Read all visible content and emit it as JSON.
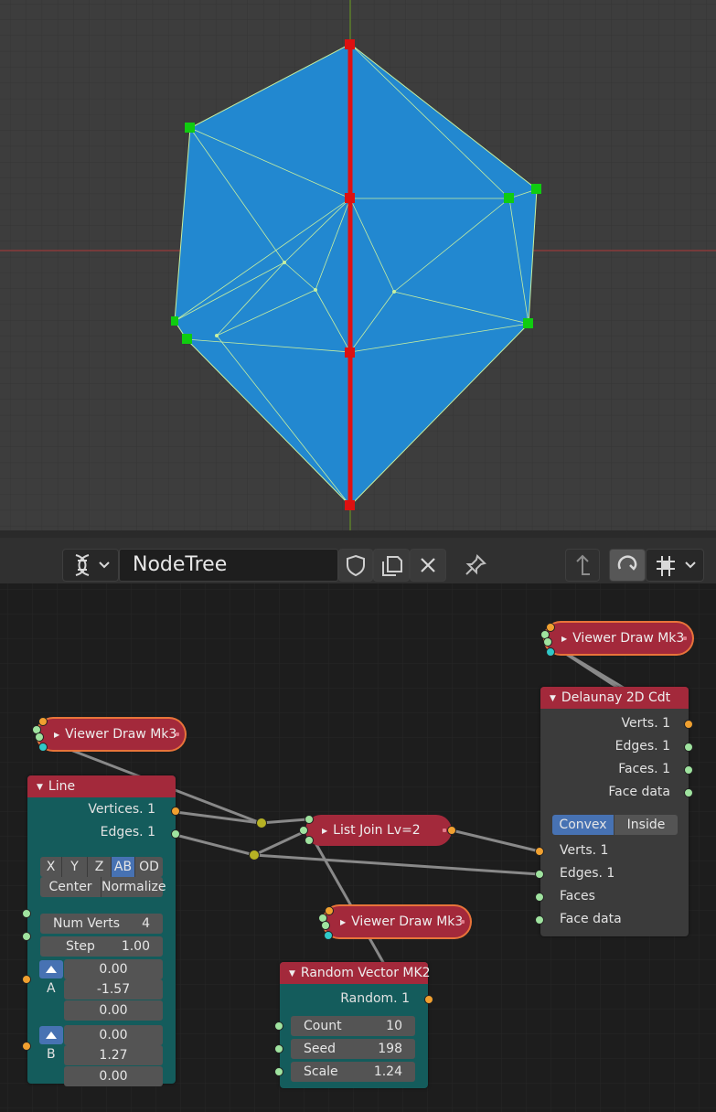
{
  "header": {
    "tree_name": "NodeTree",
    "icons": [
      "sverchok-icon",
      "chevron-down-icon",
      "shield-icon",
      "duplicate-icon",
      "close-icon",
      "pin-icon",
      "parent-tree-icon",
      "snap-icon",
      "grid-snap-icon",
      "chevron-down-icon"
    ]
  },
  "colors": {
    "mesh_fill": "#2288d0",
    "mesh_edge": "#c8f0a0",
    "vertex_green": "#10cc10",
    "vertex_red": "#dd1010",
    "line_red": "#e01010",
    "node_header": "#a3293b",
    "node_body_teal": "#145c5c",
    "node_body_grey": "#3b3b3b",
    "selection_outline": "#e8743a",
    "toggle_active": "#4772b3"
  },
  "nodes": {
    "viewer_top": {
      "title": "Viewer Draw Mk3"
    },
    "viewer_left": {
      "title": "Viewer Draw Mk3"
    },
    "viewer_mid": {
      "title": "Viewer Draw Mk3"
    },
    "list_join": {
      "title": "List Join Lv=2"
    },
    "line": {
      "title": "Line",
      "outputs": [
        "Vertices. 1",
        "Edges. 1"
      ],
      "axis_buttons": [
        "X",
        "Y",
        "Z",
        "AB",
        "OD"
      ],
      "axis_selected": "AB",
      "center_label": "Center",
      "normalize_label": "Normalize",
      "num_verts": {
        "label": "Num Verts",
        "value": "4"
      },
      "step": {
        "label": "Step",
        "value": "1.00"
      },
      "a": {
        "label": "A",
        "values": [
          "0.00",
          "-1.57",
          "0.00"
        ]
      },
      "b": {
        "label": "B",
        "values": [
          "0.00",
          "1.27",
          "0.00"
        ]
      }
    },
    "delaunay": {
      "title": "Delaunay 2D Cdt",
      "outputs": [
        "Verts. 1",
        "Edges. 1",
        "Faces. 1",
        "Face data"
      ],
      "mode_options": [
        "Convex",
        "Inside"
      ],
      "mode_selected": "Convex",
      "inputs": [
        "Verts. 1",
        "Edges. 1",
        "Faces",
        "Face data"
      ]
    },
    "random_vector": {
      "title": "Random Vector MK2",
      "output": "Random. 1",
      "count": {
        "label": "Count",
        "value": "10"
      },
      "seed": {
        "label": "Seed",
        "value": "198"
      },
      "scale": {
        "label": "Scale",
        "value": "1.24"
      }
    }
  }
}
